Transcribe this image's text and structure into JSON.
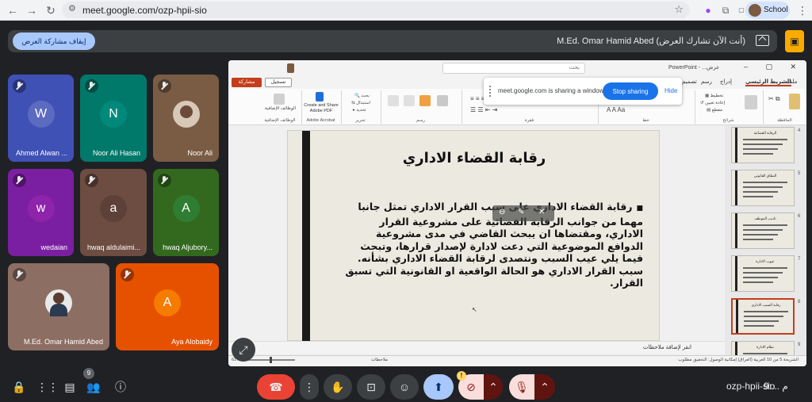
{
  "browser": {
    "url": "meet.google.com/ozp-hpii-sio",
    "profile_label": "School",
    "nav": {
      "back": "←",
      "forward": "→",
      "reload": "↻"
    }
  },
  "presentation_bar": {
    "stop_label": "إيقاف مشاركة العرض",
    "status_text": "M.Ed. Omar Hamid Abed (أنت الآن تشارك العرض)"
  },
  "participants": [
    {
      "name": "Ahmed Alwan ...",
      "initial": "W",
      "bg": "#3f51b5",
      "avatar_bg": "#5c6bc0"
    },
    {
      "name": "Noor Ali Hasan",
      "initial": "N",
      "bg": "#00796b",
      "avatar_bg": "#00897b"
    },
    {
      "name": "Noor Ali",
      "initial": "",
      "bg": "#7a5c44",
      "avatar_bg": "#d8c8b8"
    },
    {
      "name": "wedaian",
      "initial": "w",
      "bg": "#7b1fa2",
      "avatar_bg": "#8e24aa"
    },
    {
      "name": "hwaq aldulaimi...",
      "initial": "a",
      "bg": "#6d4c41",
      "avatar_bg": "#5d4037"
    },
    {
      "name": "hwaq Aljubory...",
      "initial": "A",
      "bg": "#33691e",
      "avatar_bg": "#2e7d32"
    },
    {
      "name": "M.Ed. Omar Hamid Abed",
      "initial": "",
      "bg": "#8d6e63",
      "avatar_bg": "#e8e8e8"
    },
    {
      "name": "Aya Alobaidy",
      "initial": "A",
      "bg": "#e65100",
      "avatar_bg": "#f57c00"
    }
  ],
  "ppt": {
    "search_placeholder": "بحث",
    "app_name": "PowerPoint - ...عرض",
    "tabs": [
      "ملف",
      "الشريط الرئيسي",
      "إدراج",
      "رسم",
      "تصميم",
      "انتقالات",
      "حركات",
      "عرض الشرائح",
      "تسجيل",
      "مراجعة",
      "عرض",
      "Acrobat"
    ],
    "share_label": "مشاركة",
    "record_label": "تسجيل",
    "ribbon_groups": [
      "الحافظة",
      "شرائح",
      "خط",
      "فقرة",
      "رسم",
      "تحرير",
      "Adobe Acrobat",
      "الوظائف الإضافية"
    ],
    "adobe_button": "Create and Share Adobe PDF",
    "addins_button": "الوظائف الإضافية",
    "notes_placeholder": "انقر لإضافة ملاحظات",
    "status_text": "الشريحة 5 من 10  العربية (العراق)  إمكانية الوصول: التحقيق مطلوب",
    "zoom": "61%",
    "notes_status": "ملاحظات"
  },
  "sharing_popup": {
    "text": "meet.google.com is sharing a window.",
    "stop": "Stop sharing",
    "hide": "Hide"
  },
  "slide": {
    "title": "رقابة القضاء الاداري",
    "body": "رقابة القضاء الاداري على سبب القرار الاداري تمثل جانبا مهما من جوانب الرقابة القضائية على مشروعية القرار الاداري، ومقتضاها ان يبحث القاضي في مدى مشروعية الدوافع الموضوعية التي دعت لادارة لإصدار قرارها، وتبحث فيما يلي عيب السبب ونتصدى لرقابة القضاء الاداري بشأنه. سبب القرار الاداري هو الحالة الواقعية او القانونية التي تسبق القرار."
  },
  "thumbnails": [
    {
      "num": "4",
      "title": "الرقابة القضائية"
    },
    {
      "num": "5",
      "title": "النطاق القانوني"
    },
    {
      "num": "6",
      "title": "تأديب الموظف"
    },
    {
      "num": "7",
      "title": "عيوب الادارة"
    },
    {
      "num": "8",
      "title": "رقابة السبب الاداري"
    },
    {
      "num": "9",
      "title": "نظام الادارة"
    }
  ],
  "bottom": {
    "meeting_code": "ozp-hpii-sio",
    "clock": "9:... م",
    "people_count": "9",
    "cam_warning": "!"
  }
}
